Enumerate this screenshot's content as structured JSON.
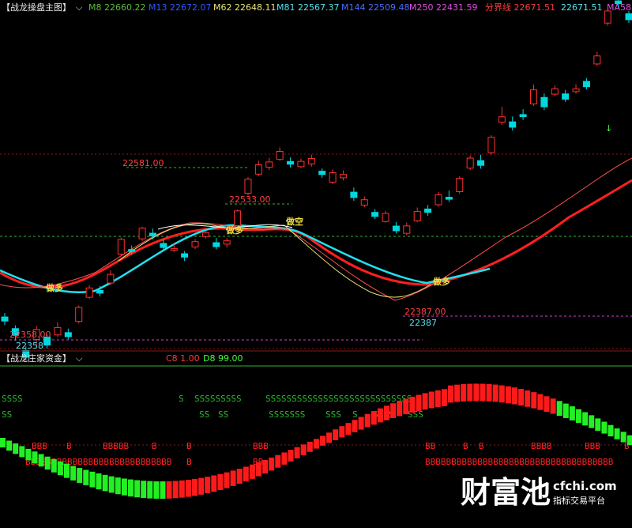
{
  "main_panel": {
    "title": "【战龙操盘主图】",
    "indicators": [
      {
        "label": "M8 22660.22",
        "color": "#5dbb3c"
      },
      {
        "label": "M13 22672.07",
        "color": "#2a5cff"
      },
      {
        "label": "M62 22648.11",
        "color": "#e8e37a"
      },
      {
        "label": "M81 22567.37",
        "color": "#55e0f0"
      },
      {
        "label": "M144 22509.48",
        "color": "#4b6bff"
      },
      {
        "label": "M250 22431.59",
        "color": "#e050e0"
      },
      {
        "label": "分界线 22671.51",
        "color": "#ff3b3b"
      },
      {
        "label": "22671.51",
        "color": "#55e0f0"
      },
      {
        "label": "MA58",
        "color": "#e050e0"
      }
    ],
    "price_labels": [
      {
        "text": "22581.00",
        "color": "#ff4040"
      },
      {
        "text": "22533.00",
        "color": "#ff4040"
      },
      {
        "text": "22387.00",
        "color": "#ff4040"
      },
      {
        "text": "22387",
        "color": "#55e0f0"
      },
      {
        "text": "22358.00",
        "color": "#ff4040"
      },
      {
        "text": "22358",
        "color": "#55e0f0"
      }
    ],
    "signals": [
      "做多",
      "做多",
      "做空",
      "做多"
    ]
  },
  "sub_panel": {
    "title": "【战龙庄家资金】",
    "values": [
      {
        "label": "C8 1.00",
        "color": "#ff3b3b"
      },
      {
        "label": "D8 99.00",
        "color": "#3cff3c"
      }
    ],
    "s_rows": [
      [
        "SSSS",
        "S",
        "SSSSSSSSS",
        "SSSSSSSSSSSSSSSSSSSSSSSSSSSS"
      ],
      [
        "SS",
        "SS",
        "SS",
        "SSSSSSS",
        "SSS",
        "S",
        "SSSS",
        "SSS"
      ]
    ],
    "b_rows": [
      [
        "BBB",
        "B",
        "BBBBB",
        "B",
        "B",
        "BBB",
        "BB",
        "B",
        "B",
        "BBBB",
        "BBB",
        "B"
      ],
      [
        "BBBBBBBBBBBBBBBBBBBBBBBBBBBB",
        "B",
        "B",
        "BB",
        "BBBBBBBBBBBBBBBBBBBBBBBBBBBBBBBBBBBB"
      ]
    ]
  },
  "watermark": {
    "brand": "财富池",
    "domain": "cfchi.com",
    "tagline": "指标交易平台"
  },
  "chart_data": {
    "type": "candlestick",
    "title": "【战龙操盘主图】",
    "y_range": [
      22340,
      22665
    ],
    "candles": [
      [
        22386,
        22380,
        22392,
        22374
      ],
      [
        22380,
        22370,
        22385,
        22362
      ],
      [
        22370,
        22360,
        22376,
        22355
      ],
      [
        22360,
        22375,
        22380,
        22352
      ],
      [
        22375,
        22363,
        22379,
        22358
      ],
      [
        22363,
        22374,
        22382,
        22360
      ],
      [
        22374,
        22368,
        22380,
        22364
      ],
      [
        22368,
        22389,
        22392,
        22365
      ],
      [
        22389,
        22403,
        22407,
        22387
      ],
      [
        22403,
        22399,
        22410,
        22394
      ],
      [
        22399,
        22412,
        22418,
        22396
      ],
      [
        22412,
        22434,
        22437,
        22410
      ],
      [
        22434,
        22431,
        22440,
        22426
      ],
      [
        22431,
        22447,
        22449,
        22428
      ],
      [
        22447,
        22443,
        22454,
        22438
      ],
      [
        22443,
        22437,
        22449,
        22432
      ],
      [
        22437,
        22439,
        22446,
        22434
      ],
      [
        22439,
        22434,
        22443,
        22428
      ],
      [
        22434,
        22442,
        22446,
        22431
      ],
      [
        22442,
        22448,
        22451,
        22439
      ],
      [
        22448,
        22442,
        22455,
        22438
      ],
      [
        22442,
        22447,
        22451,
        22437
      ],
      [
        22447,
        22469,
        22471,
        22445
      ],
      [
        22469,
        22490,
        22493,
        22466
      ],
      [
        22490,
        22504,
        22510,
        22487
      ],
      [
        22504,
        22512,
        22518,
        22500
      ],
      [
        22512,
        22524,
        22530,
        22510
      ],
      [
        22524,
        22520,
        22530,
        22515
      ],
      [
        22520,
        22528,
        22532,
        22518
      ],
      [
        22528,
        22536,
        22542,
        22524
      ],
      [
        22536,
        22531,
        22540,
        22526
      ],
      [
        22531,
        22545,
        22550,
        22528
      ],
      [
        22545,
        22550,
        22556,
        22541
      ],
      [
        22550,
        22542,
        22557,
        22537
      ],
      [
        22542,
        22550,
        22555,
        22539
      ],
      [
        22550,
        22544,
        22555,
        22540
      ],
      [
        22544,
        22556,
        22560,
        22542
      ],
      [
        22556,
        22549,
        22562,
        22545
      ],
      [
        22549,
        22560,
        22565,
        22546
      ],
      [
        22560,
        22574,
        22580,
        22558
      ],
      [
        22574,
        22569,
        22580,
        22564
      ],
      [
        22569,
        22584,
        22588,
        22566
      ],
      [
        22584,
        22581,
        22594,
        22577
      ],
      [
        22581,
        22601,
        22604,
        22578
      ],
      [
        22601,
        22616,
        22620,
        22598
      ],
      [
        22616,
        22609,
        22625,
        22604
      ],
      [
        22609,
        22632,
        22635,
        22606
      ],
      [
        22632,
        22640,
        22655,
        22628
      ],
      [
        22640,
        22632,
        22648,
        22627
      ],
      [
        22632,
        22629,
        22640,
        22624
      ],
      [
        22629,
        22650,
        22658,
        22626
      ],
      [
        22650,
        22636,
        22656,
        22631
      ],
      [
        22636,
        22644,
        22649,
        22633
      ],
      [
        22644,
        22636,
        22650,
        22632
      ],
      [
        22636,
        22640,
        22647,
        22633
      ],
      [
        22640,
        22632,
        22645,
        22628
      ],
      [
        22632,
        22644,
        22650,
        22629
      ],
      [
        22644,
        22662,
        22665,
        22640
      ],
      [
        22662,
        22658,
        22665,
        22652
      ],
      [
        22658,
        22649,
        22662,
        22644
      ]
    ]
  }
}
